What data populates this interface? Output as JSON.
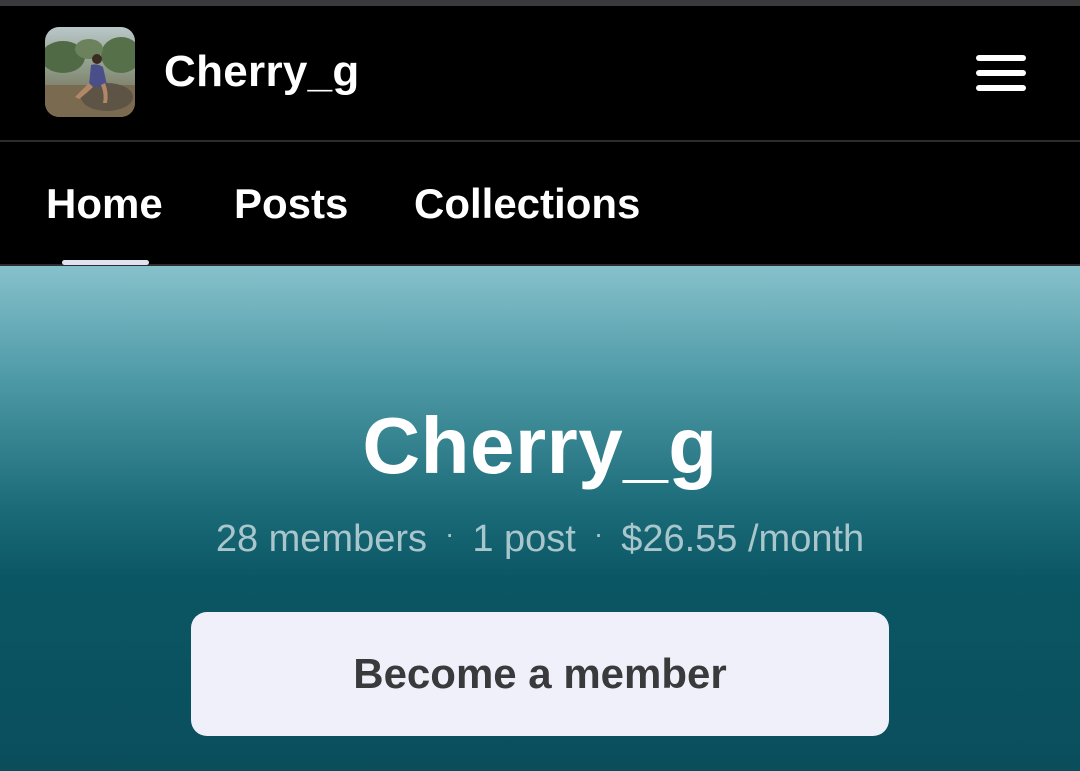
{
  "header": {
    "creator_name": "Cherry_g",
    "avatar_icon": "profile-photo",
    "menu_icon": "hamburger-menu-icon"
  },
  "tabs": [
    {
      "label": "Home",
      "active": true
    },
    {
      "label": "Posts",
      "active": false
    },
    {
      "label": "Collections",
      "active": false
    }
  ],
  "hero": {
    "title": "Cherry_g",
    "stats": {
      "members": "28 members",
      "posts": "1 post",
      "price": "$26.55 /month",
      "separator": "·"
    },
    "cta_label": "Become a member"
  },
  "colors": {
    "background": "#000000",
    "hero_gradient_top": "#86c1cb",
    "hero_gradient_bottom": "#0a4e5c",
    "button_bg": "#eff0fa",
    "button_text": "#3a3a3c",
    "stats_text": "#a8c6cc"
  }
}
